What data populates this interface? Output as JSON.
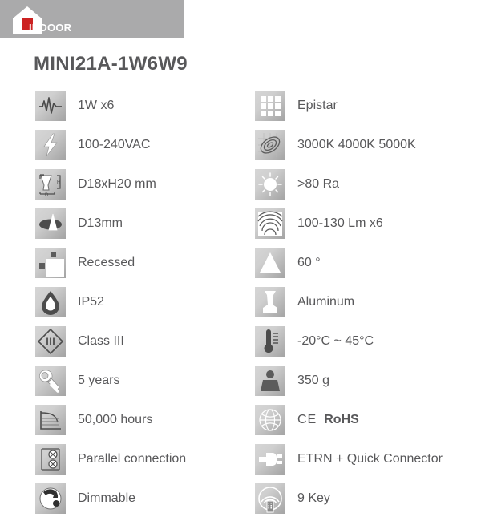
{
  "header": {
    "label": "INDOOR",
    "logo_icon": "house-icon",
    "bar_color": "#aaaaab",
    "logo_accent_color": "#cc2222"
  },
  "product": {
    "title": "MINI21A-1W6W9"
  },
  "specs": {
    "left_column": [
      {
        "icon": "waveform-power-icon",
        "label": "1W x6"
      },
      {
        "icon": "lightning-bolt-icon",
        "label": "100-240VAC"
      },
      {
        "icon": "fixture-dimensions-icon",
        "label": "D18xH20 mm"
      },
      {
        "icon": "cutout-diameter-icon",
        "label": "D13mm"
      },
      {
        "icon": "recessed-mount-icon",
        "label": "Recessed"
      },
      {
        "icon": "water-drop-ip-icon",
        "label": "IP52"
      },
      {
        "icon": "class-diamond-icon",
        "label": "Class III"
      },
      {
        "icon": "wrench-warranty-icon",
        "label": "5 years"
      },
      {
        "icon": "lifetime-graph-icon",
        "label": "50,000 hours"
      },
      {
        "icon": "parallel-circuit-icon",
        "label": "Parallel connection"
      },
      {
        "icon": "dimmer-knob-icon",
        "label": "Dimmable"
      }
    ],
    "right_column": [
      {
        "icon": "led-chip-grid-icon",
        "label": "Epistar"
      },
      {
        "icon": "color-temperature-icon",
        "label": "3000K 4000K 5000K"
      },
      {
        "icon": "sun-cri-icon",
        "label": ">80 Ra"
      },
      {
        "icon": "luminous-flux-icon",
        "label": "100-130 Lm x6"
      },
      {
        "icon": "beam-angle-icon",
        "label": "60 °"
      },
      {
        "icon": "housing-material-icon",
        "label": "Aluminum"
      },
      {
        "icon": "thermometer-icon",
        "label": "-20°C ~ 45°C"
      },
      {
        "icon": "weight-icon",
        "label": "350 g"
      },
      {
        "icon": "globe-certification-icon",
        "label": "CE RoHS",
        "ce": "CE",
        "rohs": "RoHS"
      },
      {
        "icon": "plug-connector-icon",
        "label": "ETRN + Quick Connector"
      },
      {
        "icon": "remote-control-icon",
        "label": "9 Key"
      }
    ]
  }
}
